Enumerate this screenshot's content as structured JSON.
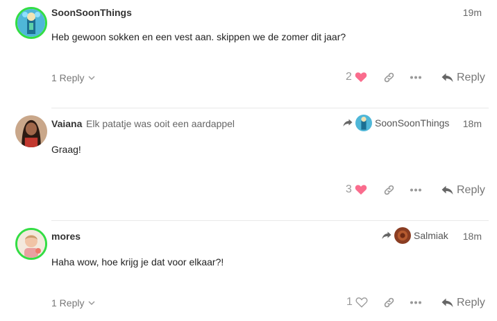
{
  "posts": [
    {
      "username": "SoonSoonThings",
      "user_title": "",
      "time": "19m",
      "body": "Heb gewoon sokken en een vest aan. skippen we de zomer dit jaar?",
      "replies_label": "1 Reply",
      "likes": "2",
      "liked": true,
      "reply_label": "Reply"
    },
    {
      "username": "Vaiana",
      "user_title": "Elk patatje was ooit een aardappel",
      "reply_to": "SoonSoonThings",
      "time": "18m",
      "body": "Graag!",
      "likes": "3",
      "liked": true,
      "reply_label": "Reply"
    },
    {
      "username": "mores",
      "user_title": "",
      "reply_to": "Salmiak",
      "time": "18m",
      "body": "Haha wow, hoe krijg je dat voor elkaar?!",
      "replies_label": "1 Reply",
      "likes": "1",
      "liked": false,
      "reply_label": "Reply"
    }
  ],
  "colors": {
    "heart_liked": "#fa6c8d",
    "avatar_ring": "#33dd44",
    "muted_text": "#777777"
  }
}
